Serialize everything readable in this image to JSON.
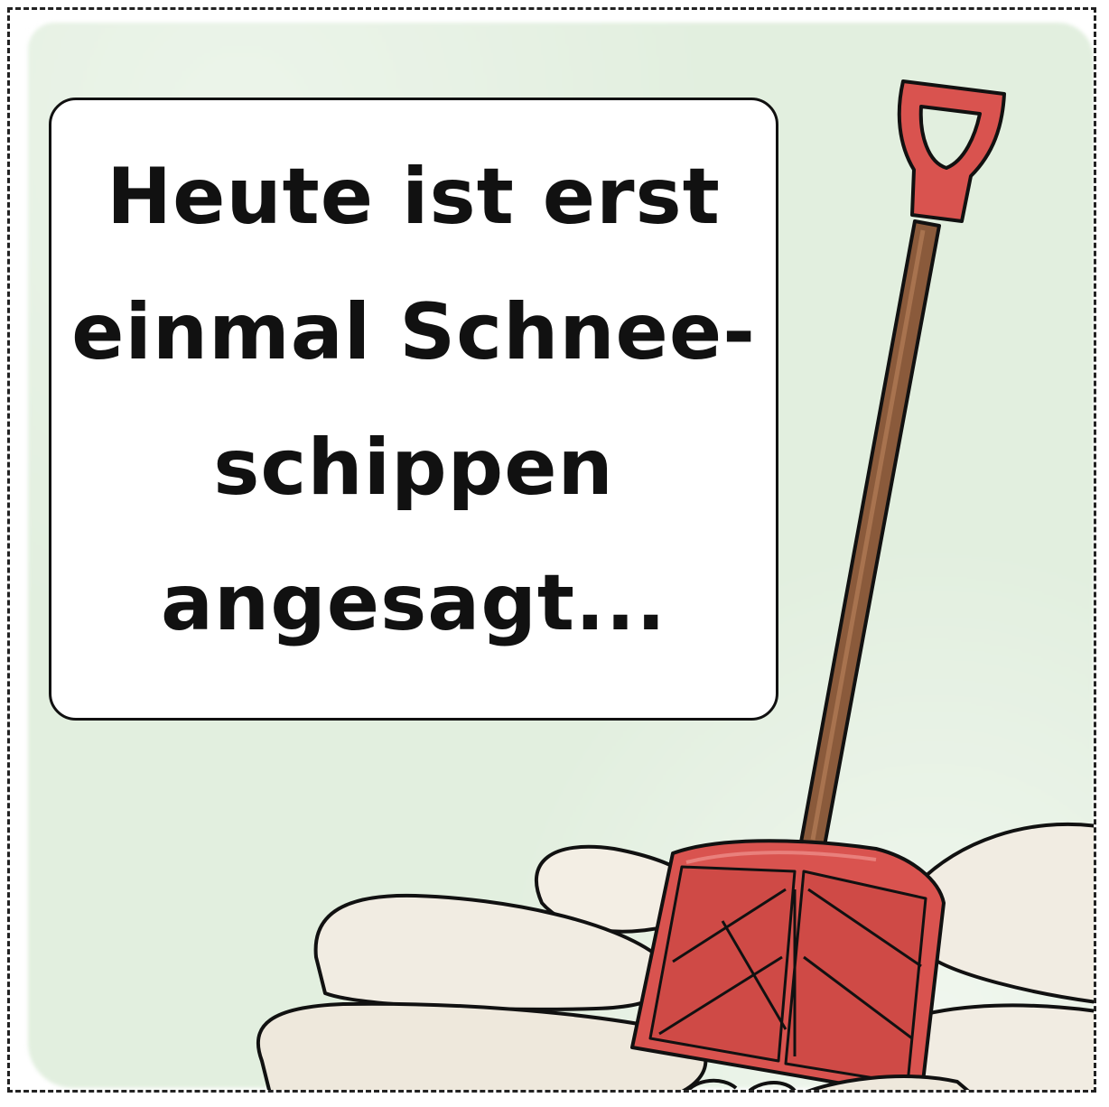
{
  "speech_bubble": {
    "lines": [
      "Heute ist erst",
      "einmal Schnee-",
      "schippen",
      "angesagt..."
    ]
  },
  "illustration": {
    "subject": "snow-shovel",
    "colors": {
      "background_wash": "#e2efdf",
      "shovel_red": "#d9534f",
      "shovel_red_dark": "#c0403c",
      "handle_brown": "#8a5a3b",
      "snow": "#f1ece2",
      "outline": "#111111"
    }
  }
}
